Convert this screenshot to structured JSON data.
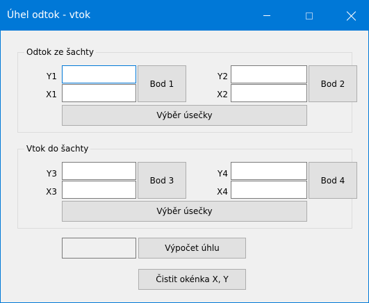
{
  "window": {
    "title": "Úhel odtok - vtok",
    "controls": {
      "minimize_icon": "minimize-icon",
      "maximize_icon": "maximize-icon",
      "close_icon": "close-icon"
    },
    "accent_color": "#0078d7"
  },
  "group_outflow": {
    "legend": "Odtok ze šachty",
    "y1_label": "Y1",
    "x1_label": "X1",
    "y2_label": "Y2",
    "x2_label": "X2",
    "y1_value": "",
    "x1_value": "",
    "y2_value": "",
    "x2_value": "",
    "point1_button": "Bod 1",
    "point2_button": "Bod 2",
    "select_segment_button": "Výběr úsečky"
  },
  "group_inflow": {
    "legend": "Vtok do šachty",
    "y3_label": "Y3",
    "x3_label": "X3",
    "y4_label": "Y4",
    "x4_label": "X4",
    "y3_value": "",
    "x3_value": "",
    "y4_value": "",
    "x4_value": "",
    "point3_button": "Bod 3",
    "point4_button": "Bod 4",
    "select_segment_button": "Výběr úsečky"
  },
  "actions": {
    "angle_result": "",
    "compute_angle_button": "Výpočet úhlu",
    "clear_button": "Čistit okénka X, Y"
  }
}
